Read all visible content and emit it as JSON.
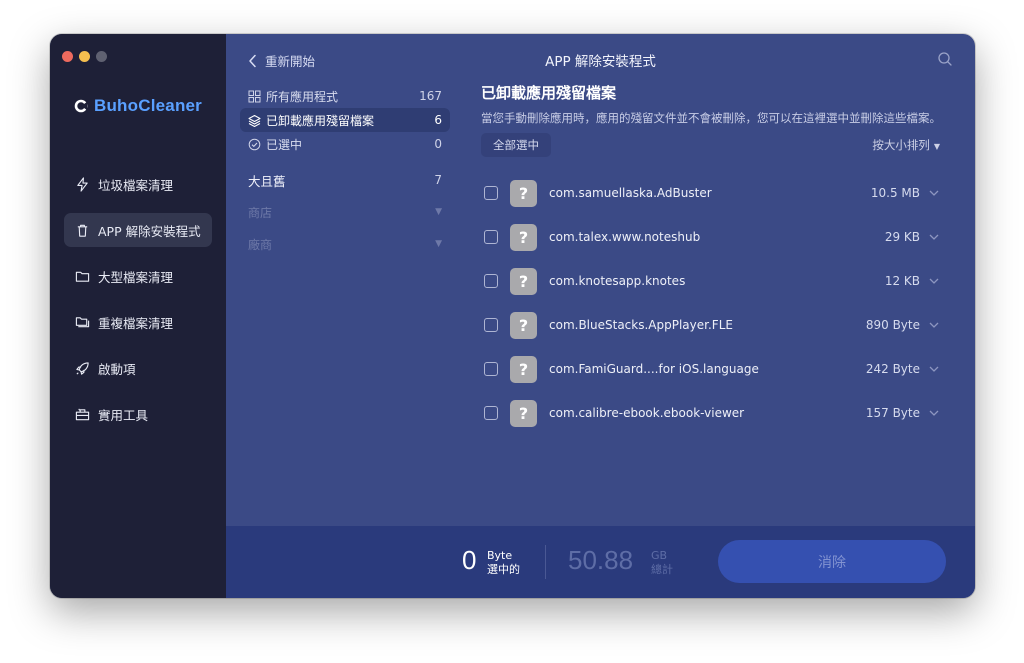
{
  "app": {
    "name": "BuhoCleaner"
  },
  "window": {
    "title": "APP 解除安裝程式"
  },
  "header": {
    "back_label": "重新開始"
  },
  "sidebar": {
    "items": [
      {
        "label": "垃圾檔案清理",
        "icon": "lightning-icon"
      },
      {
        "label": "APP 解除安裝程式",
        "icon": "trash-icon",
        "active": true
      },
      {
        "label": "大型檔案清理",
        "icon": "folder-icon"
      },
      {
        "label": "重複檔案清理",
        "icon": "duplicate-folder-icon"
      },
      {
        "label": "啟動項",
        "icon": "rocket-icon"
      },
      {
        "label": "實用工具",
        "icon": "toolbox-icon"
      }
    ]
  },
  "categories": {
    "all": {
      "label": "所有應用程式",
      "count": "167"
    },
    "leftovers": {
      "label": "已卸載應用殘留檔案",
      "count": "6"
    },
    "selected": {
      "label": "已選中",
      "count": "0"
    },
    "old_large": {
      "label": "大且舊",
      "count": "7"
    },
    "store": {
      "label": "商店"
    },
    "vendor": {
      "label": "廠商"
    }
  },
  "content": {
    "title": "已卸載應用殘留檔案",
    "description": "當您手動刪除應用時，應用的殘留文件並不會被刪除，您可以在這裡選中並刪除這些檔案。",
    "select_all": "全部選中",
    "sort": "按大小排列",
    "items": [
      {
        "name": "com.samuellaska.AdBuster",
        "size": "10.5 MB"
      },
      {
        "name": "com.talex.www.noteshub",
        "size": "29 KB"
      },
      {
        "name": "com.knotesapp.knotes",
        "size": "12 KB"
      },
      {
        "name": "com.BlueStacks.AppPlayer.FLE",
        "size": "890 Byte"
      },
      {
        "name": "com.FamiGuard....for iOS.language",
        "size": "242 Byte"
      },
      {
        "name": "com.calibre-ebook.ebook-viewer",
        "size": "157 Byte"
      }
    ]
  },
  "footer": {
    "selected_value": "0",
    "selected_unit": "Byte",
    "selected_label": "選中的",
    "total_value": "50.88",
    "total_unit": "GB",
    "total_label": "總計",
    "remove_label": "消除"
  },
  "colors": {
    "sidebar_bg": "#1e2037",
    "main_bg": "#3b4a86",
    "bottom_bg": "#2a3a7c",
    "brand": "#5aa0ff",
    "remove_button": "#3550b0"
  }
}
